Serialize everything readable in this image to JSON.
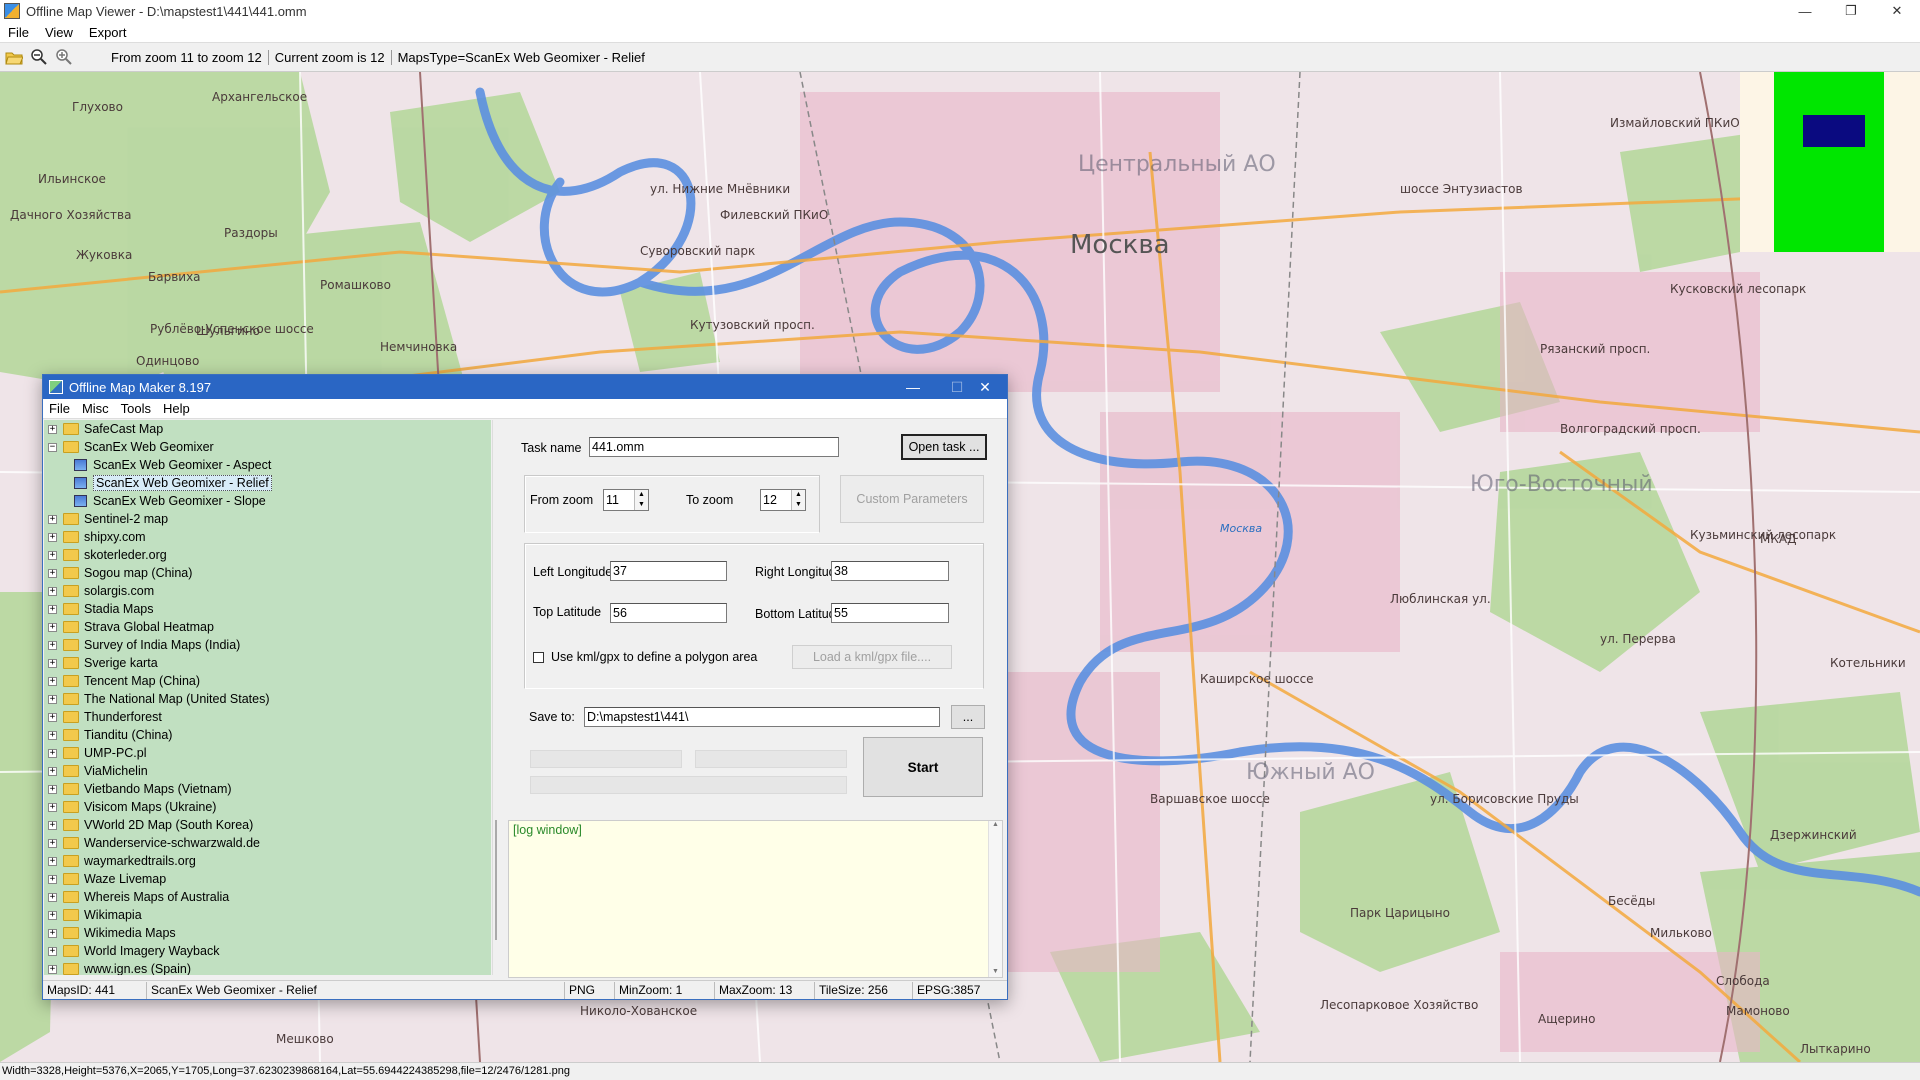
{
  "window": {
    "title": "Offline Map Viewer - D:\\mapstest1\\441\\441.omm",
    "controls": {
      "minimize": "—",
      "restore": "❐",
      "close": "✕"
    }
  },
  "menu": [
    "File",
    "View",
    "Export"
  ],
  "toolbar": {
    "icons": [
      "open-folder-icon",
      "zoom-out-icon",
      "zoom-in-icon"
    ],
    "zoom_range": "From zoom 11 to zoom 12",
    "current_zoom": "Current zoom is 12",
    "maps_type": "MapsType=ScanEx Web Geomixer - Relief"
  },
  "map": {
    "center_label": "Москва",
    "districts": [
      "Центральный АО",
      "Юго-Восточный",
      "Южный АО"
    ],
    "places": [
      "Архангельское",
      "Глухово",
      "Ильинское",
      "Дачного Хозяйства",
      "Жуковка",
      "Раздоры",
      "Барвиха",
      "Ромашково",
      "Шульгино",
      "Немчиновка",
      "Одинцово",
      "Филевский ПКиО",
      "Суворовский парк",
      "Измайловский ПКиО",
      "Кусковский лесопарк",
      "Кузьминский лесопарк",
      "Котельники",
      "Дзержинский",
      "Парк Царицыно",
      "Лесопарковое Хозяйство",
      "Бесёды",
      "Мильково",
      "Слобода",
      "Мамоново",
      "Ащерино",
      "Николо-Хованское",
      "Мешково",
      "Лыткарино"
    ],
    "streets": [
      "Рублёво-Успенское шоссе",
      "Кутузовский просп.",
      "ул. Нижние Мнёвники",
      "Волгоградский просп.",
      "Рязанский просп.",
      "Каширское шоссе",
      "Варшавское шоссе",
      "Люблинская ул.",
      "ул. Перерва",
      "ул. Борисовские Пруды",
      "шоссе Энтузиастов",
      "МКАД",
      "Москва"
    ],
    "minimap": {
      "outline_color": "#00e600",
      "viewport_color": "#0a0a80",
      "background": "#fdf5e6"
    }
  },
  "statusbar": "Width=3328,Height=5376,X=2065,Y=1705,Long=37.6230239868164,Lat=55.6944224385298,file=12/2476/1281.png",
  "dialog": {
    "title": "Offline Map Maker 8.197",
    "menu": [
      "File",
      "Misc",
      "Tools",
      "Help"
    ],
    "tree": [
      {
        "label": "SafeCast Map",
        "expanded": false
      },
      {
        "label": "ScanEx Web Geomixer",
        "expanded": true
      },
      {
        "label": "ScanEx Web Geomixer - Aspect",
        "child": true
      },
      {
        "label": "ScanEx Web Geomixer - Relief",
        "child": true,
        "selected": true
      },
      {
        "label": "ScanEx Web Geomixer - Slope",
        "child": true
      },
      {
        "label": "Sentinel-2 map"
      },
      {
        "label": "shipxy.com"
      },
      {
        "label": "skoterleder.org"
      },
      {
        "label": "Sogou map (China)"
      },
      {
        "label": "solargis.com"
      },
      {
        "label": "Stadia Maps"
      },
      {
        "label": "Strava Global Heatmap"
      },
      {
        "label": "Survey of India Maps (India)"
      },
      {
        "label": "Sverige karta"
      },
      {
        "label": "Tencent Map (China)"
      },
      {
        "label": "The National Map (United States)"
      },
      {
        "label": "Thunderforest"
      },
      {
        "label": "Tianditu (China)"
      },
      {
        "label": "UMP-PC.pl"
      },
      {
        "label": "ViaMichelin"
      },
      {
        "label": "Vietbando Maps (Vietnam)"
      },
      {
        "label": "Visicom Maps (Ukraine)"
      },
      {
        "label": "VWorld 2D Map (South Korea)"
      },
      {
        "label": "Wanderservice-schwarzwald.de"
      },
      {
        "label": "waymarkedtrails.org"
      },
      {
        "label": "Waze Livemap"
      },
      {
        "label": "Whereis Maps of Australia"
      },
      {
        "label": "Wikimapia"
      },
      {
        "label": "Wikimedia Maps"
      },
      {
        "label": "World Imagery Wayback"
      },
      {
        "label": "www.ign.es (Spain)"
      }
    ],
    "task_name_label": "Task name",
    "task_name_value": "441.omm",
    "open_task_label": "Open task ...",
    "from_zoom_label": "From zoom",
    "from_zoom_value": "11",
    "to_zoom_label": "To zoom",
    "to_zoom_value": "12",
    "custom_params_label": "Custom Parameters",
    "left_lon_label": "Left Longitude",
    "left_lon_value": "37",
    "right_lon_label": "Right Longitude",
    "right_lon_value": "38",
    "top_lat_label": "Top Latitude",
    "top_lat_value": "56",
    "bottom_lat_label": "Bottom Latitude",
    "bottom_lat_value": "55",
    "kml_checkbox_label": "Use kml/gpx to define a polygon area",
    "load_kml_label": "Load a kml/gpx file....",
    "save_to_label": "Save to:",
    "save_to_value": "D:\\mapstest1\\441\\",
    "browse_label": "...",
    "start_label": "Start",
    "log_text": "[log window]",
    "status": {
      "maps_id": "MapsID: 441",
      "map_name": "ScanEx Web Geomixer - Relief",
      "format": "PNG",
      "min_zoom": "MinZoom: 1",
      "max_zoom": "MaxZoom: 13",
      "tile_size": "TileSize: 256",
      "epsg": "EPSG:3857"
    }
  }
}
